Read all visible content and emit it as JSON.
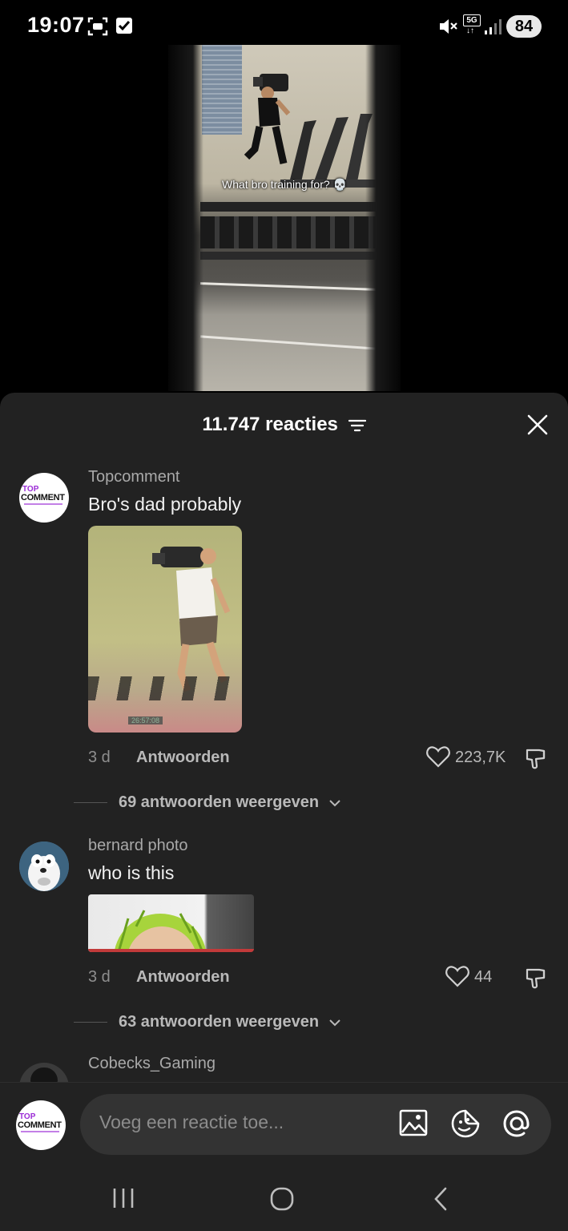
{
  "status_bar": {
    "time": "19:07",
    "battery": "84",
    "network": "5G"
  },
  "video": {
    "caption": "What bro training for? 💀"
  },
  "comments_sheet": {
    "count_label": "11.747 reacties",
    "comments": [
      {
        "username": "Topcomment",
        "text": "Bro's dad probably",
        "age": "3 d",
        "reply_label": "Antwoorden",
        "likes": "223,7K",
        "view_replies": "69 antwoorden weergeven",
        "media_overlay": "26:57:08"
      },
      {
        "username": "bernard photo",
        "text": "who is this",
        "age": "3 d",
        "reply_label": "Antwoorden",
        "likes": "44",
        "view_replies": "63 antwoorden weergeven"
      },
      {
        "username": "Cobecks_Gaming"
      }
    ]
  },
  "input": {
    "placeholder": "Voeg een reactie toe..."
  },
  "logo": {
    "top": "TOP",
    "comment": "COMMENT"
  },
  "colors": {
    "sheet_bg": "#222222",
    "accent_purple": "#9b2cd6"
  }
}
